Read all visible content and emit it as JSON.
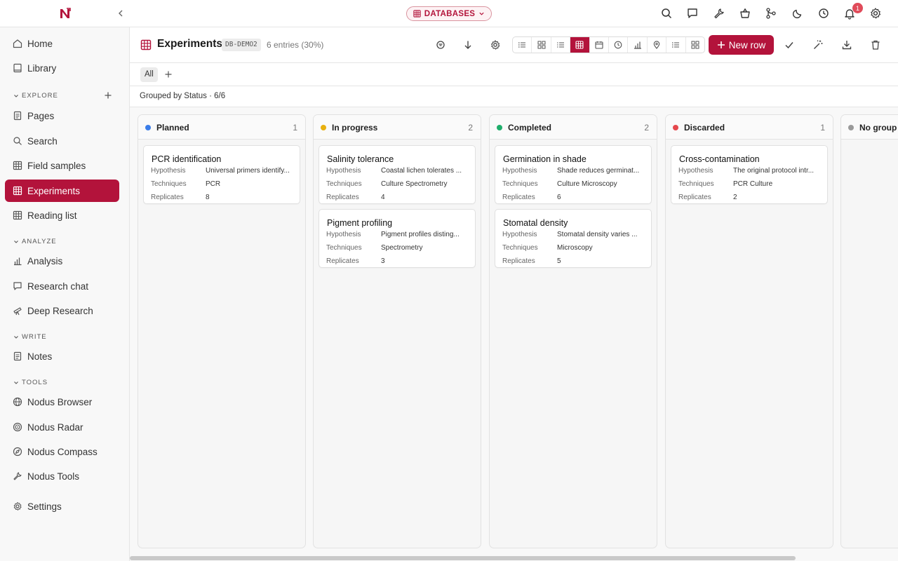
{
  "topbar": {
    "databases_label": "DATABASES",
    "notification_count": "1"
  },
  "sidebar": {
    "home": "Home",
    "library": "Library",
    "explore_label": "EXPLORE",
    "pages": "Pages",
    "search": "Search",
    "field_samples": "Field samples",
    "experiments": "Experiments",
    "reading_list": "Reading list",
    "analyze_label": "ANALYZE",
    "analysis": "Analysis",
    "research_chat": "Research chat",
    "deep_research": "Deep Research",
    "write_label": "WRITE",
    "notes": "Notes",
    "tools_label": "TOOLS",
    "nodus_browser": "Nodus Browser",
    "nodus_radar": "Nodus Radar",
    "nodus_compass": "Nodus Compass",
    "nodus_tools": "Nodus Tools",
    "settings": "Settings"
  },
  "header": {
    "title": "Experiments",
    "db_id": "DB-DEMO2",
    "entries": "6 entries (30%)",
    "new_row_label": "New row"
  },
  "tabs": {
    "all": "All"
  },
  "group_label": "Grouped by Status · 6/6",
  "field_labels": {
    "hypothesis": "Hypothesis",
    "techniques": "Techniques",
    "replicates": "Replicates"
  },
  "columns": [
    {
      "name": "Planned",
      "count": "1",
      "color": "#3b7de9",
      "cards": [
        {
          "title": "PCR identification",
          "hypothesis": "Universal primers identify...",
          "techniques": "PCR",
          "replicates": "8"
        }
      ]
    },
    {
      "name": "In progress",
      "count": "2",
      "color": "#e8b00f",
      "cards": [
        {
          "title": "Salinity tolerance",
          "hypothesis": "Coastal lichen tolerates ...",
          "techniques": "Culture Spectrometry",
          "replicates": "4"
        },
        {
          "title": "Pigment profiling",
          "hypothesis": "Pigment profiles disting...",
          "techniques": "Spectrometry",
          "replicates": "3"
        }
      ]
    },
    {
      "name": "Completed",
      "count": "2",
      "color": "#1fae6b",
      "cards": [
        {
          "title": "Germination in shade",
          "hypothesis": "Shade reduces germinat...",
          "techniques": "Culture Microscopy",
          "replicates": "6"
        },
        {
          "title": "Stomatal density",
          "hypothesis": "Stomatal density varies ...",
          "techniques": "Microscopy",
          "replicates": "5"
        }
      ]
    },
    {
      "name": "Discarded",
      "count": "1",
      "color": "#e5484d",
      "cards": [
        {
          "title": "Cross-contamination",
          "hypothesis": "The original protocol intr...",
          "techniques": "PCR Culture",
          "replicates": "2"
        }
      ]
    },
    {
      "name": "No group",
      "count": "",
      "color": "#9a9a9a",
      "cards": []
    }
  ],
  "colors": {
    "accent": "#b3133b"
  }
}
